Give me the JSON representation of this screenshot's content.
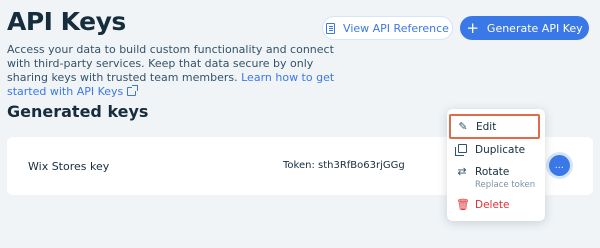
{
  "header": {
    "title": "API Keys",
    "description": "Access your data to build custom functionality and connect with third-party services. Keep that data secure by only sharing keys with trusted team members.",
    "learn_link": "Learn how to get started with API Keys"
  },
  "actions": {
    "view_reference": "View API Reference",
    "generate": "Generate API Key"
  },
  "section": {
    "title": "Generated keys"
  },
  "keys": [
    {
      "name": "Wix Stores key",
      "token": "Token: sth3RfBo63rjGGg"
    }
  ],
  "menu": {
    "edit": "Edit",
    "duplicate": "Duplicate",
    "rotate": "Rotate",
    "rotate_sub": "Replace token",
    "delete": "Delete"
  },
  "more_icon": "…",
  "colors": {
    "accent": "#3b78e7",
    "danger": "#df3131",
    "highlight_border": "#e06a4a",
    "background": "#f0f4f7"
  },
  "icons": {
    "view_reference": "document-icon",
    "generate": "plus-icon",
    "edit": "pencil-icon",
    "duplicate": "duplicate-icon",
    "rotate": "rotate-icon",
    "delete": "trash-icon",
    "learn_link": "external-link-icon"
  }
}
